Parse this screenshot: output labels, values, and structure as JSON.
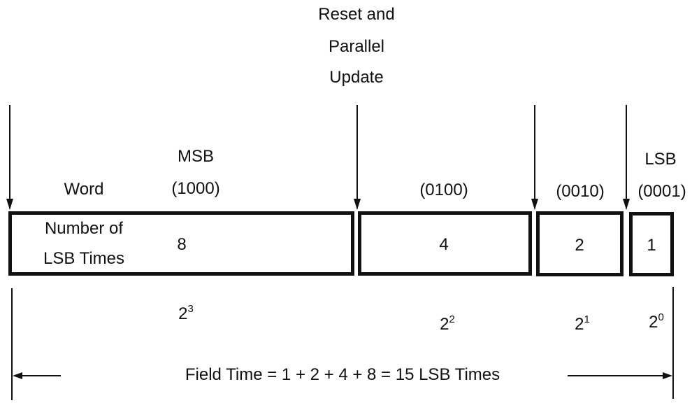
{
  "title": [
    "Reset and",
    "Parallel",
    "Update"
  ],
  "word_label": "Word",
  "word_sub": [
    "Number of",
    "LSB Times"
  ],
  "bits": [
    {
      "name": "MSB",
      "code": "(1000)",
      "weight": 8,
      "power_base": "2",
      "power_exp": "3"
    },
    {
      "name": "",
      "code": "(0100)",
      "weight": 4,
      "power_base": "2",
      "power_exp": "2"
    },
    {
      "name": "",
      "code": "(0010)",
      "weight": 2,
      "power_base": "2",
      "power_exp": "1"
    },
    {
      "name": "LSB",
      "code": "(0001)",
      "weight": 1,
      "power_base": "2",
      "power_exp": "0"
    }
  ],
  "field_time": "Field Time = 1 + 2 + 4 + 8 = 15 LSB Times",
  "colors": {
    "stroke": "#111111",
    "background": "#ffffff"
  }
}
